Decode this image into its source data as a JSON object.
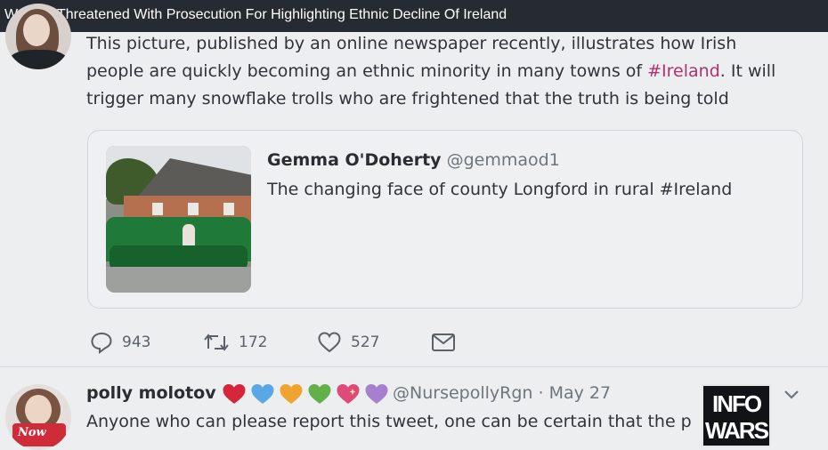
{
  "title_bar": {
    "headline": "Woman Threatened With Prosecution For Highlighting Ethnic Decline Of Ireland"
  },
  "tweet": {
    "text_line1": "This picture, published by an online newspaper recently, illustrates how Irish",
    "text_line2_before": "people are quickly becoming an ethnic minority in many towns of ",
    "text_line2_hashtag": "#Ireland",
    "text_line2_after": ". It will",
    "text_line3": "trigger many snowflake trolls who are frightened that the truth is being told",
    "quote": {
      "author_name": "Gemma O'Doherty",
      "author_handle": "@gemmaod1",
      "text": "The changing face of county Longford in rural #Ireland"
    },
    "actions": {
      "replies": "943",
      "retweets": "172",
      "likes": "527"
    }
  },
  "reply": {
    "name": "polly molotov",
    "meta": "@NursepollyRgn · May 27",
    "text": "Anyone who can please report this tweet, one can be certain that the p",
    "hearts": [
      "red-heart-icon",
      "blue-heart-icon",
      "yellow-heart-icon",
      "green-heart-icon",
      "sparkling-heart-icon",
      "purple-heart-icon"
    ]
  },
  "overlay_logo": {
    "line1": "INFO",
    "line2": "WARS"
  },
  "colors": {
    "title_bar_bg": "#262b33",
    "hashtag": "#b0326d",
    "background": "#eceef0"
  }
}
